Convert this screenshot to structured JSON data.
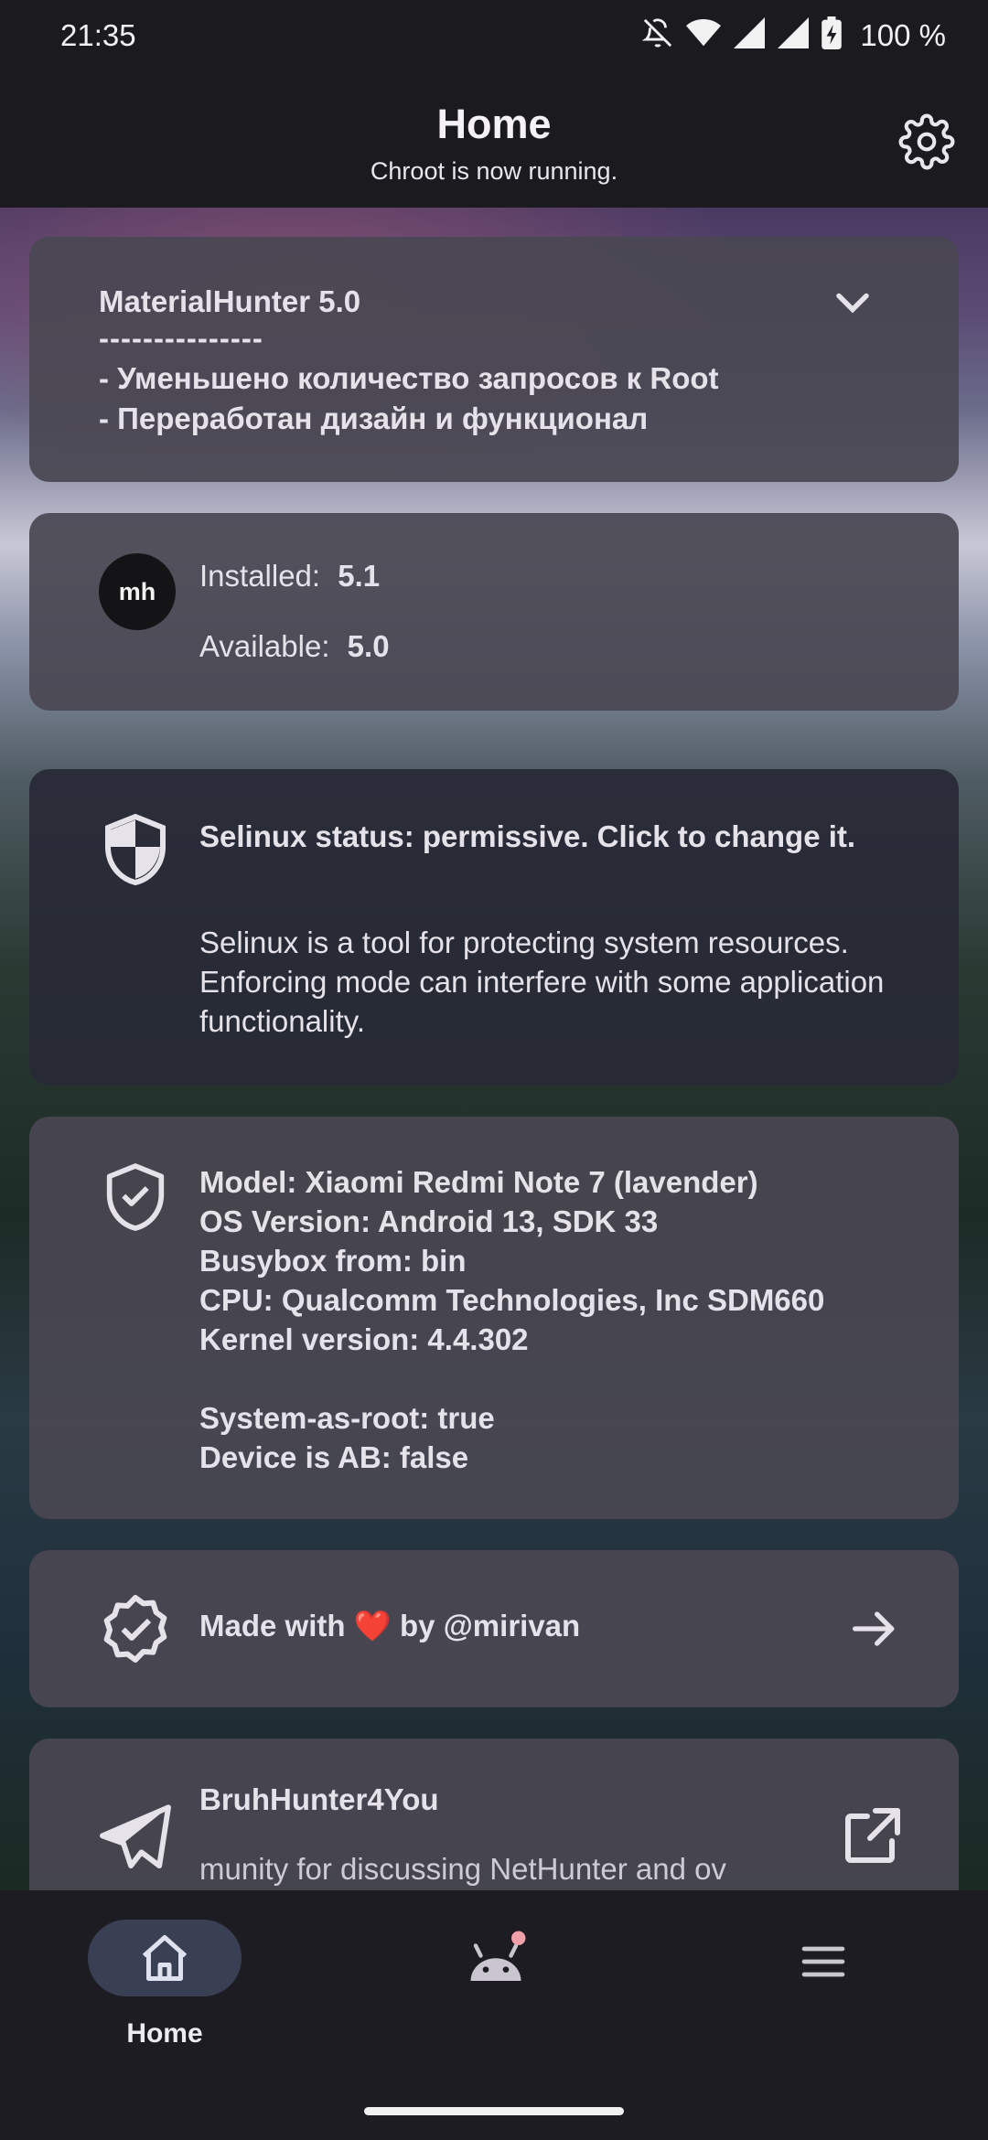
{
  "status_bar": {
    "time": "21:35",
    "battery": "100 %",
    "icons": [
      "bell-off-icon",
      "wifi-icon",
      "signal-icon",
      "signal-icon",
      "battery-charging-icon"
    ]
  },
  "header": {
    "title": "Home",
    "subtitle": "Chroot is now running.",
    "settings_icon": "gear-icon"
  },
  "changelog_card": {
    "title": "MaterialHunter 5.0",
    "divider": "---------------",
    "line1": "- Уменьшено количество запросов к Root",
    "line2": "- Переработан дизайн и функционал",
    "expand_icon": "chevron-down-icon"
  },
  "version_card": {
    "avatar": "mh",
    "installed_label": "Installed:",
    "installed_value": "5.1",
    "available_label": "Available:",
    "available_value": "5.0"
  },
  "selinux_card": {
    "icon": "shield-half-icon",
    "title": "Selinux status: permissive. Click to change it.",
    "description": "Selinux is a tool for protecting system resources. Enforcing mode can interfere with some application functionality."
  },
  "device_card": {
    "icon": "shield-check-icon",
    "model": "Model: Xiaomi Redmi Note 7 (lavender)",
    "os_version": "OS Version: Android 13, SDK 33",
    "busybox": "Busybox from: bin",
    "cpu": "CPU: Qualcomm Technologies, Inc SDM660",
    "kernel": "Kernel version: 4.4.302",
    "system_as_root": "System-as-root: true",
    "device_ab": "Device is AB: false"
  },
  "credits_card": {
    "icon": "verified-badge-icon",
    "prefix": "Made with",
    "heart": "❤️",
    "suffix": "by @mirivan",
    "arrow_icon": "arrow-right-icon"
  },
  "telegram_card": {
    "icon": "telegram-icon",
    "title": "BruhHunter4You",
    "description": "munity for discussing NetHunter and ov",
    "open_icon": "open-external-icon"
  },
  "bottom_nav": {
    "home_label": "Home",
    "home_icon": "home-icon",
    "android_icon": "android-icon",
    "menu_icon": "menu-icon",
    "accent": "#f0a0a8"
  }
}
